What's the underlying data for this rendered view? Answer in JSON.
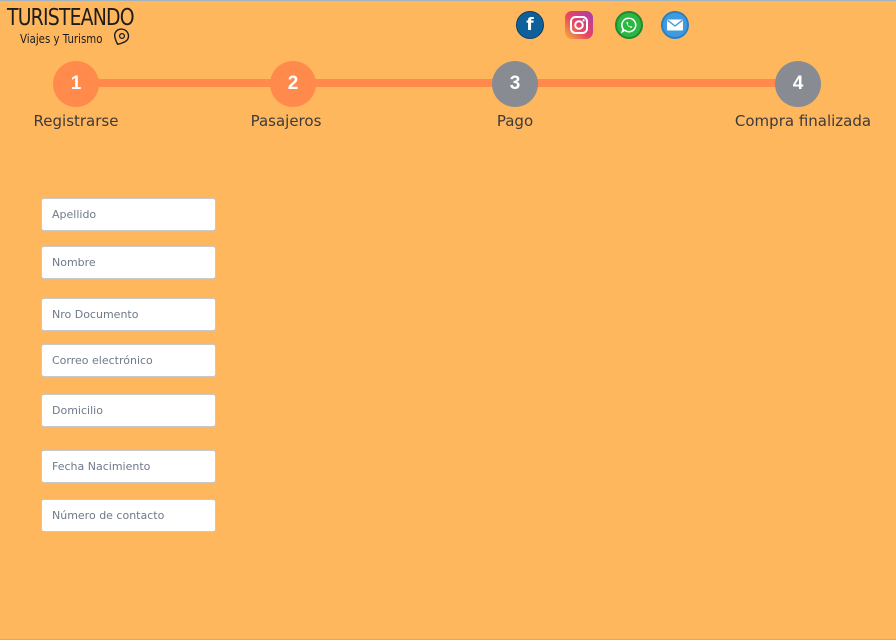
{
  "logo": {
    "title": "TURISTEANDO",
    "subtitle": "Viajes y Turismo"
  },
  "social": {
    "facebook_icon": "facebook-icon",
    "instagram_icon": "instagram-icon",
    "whatsapp_icon": "whatsapp-icon",
    "email_icon": "email-icon",
    "facebook_letter": "f"
  },
  "stepper": {
    "steps": [
      {
        "number": "1",
        "label": "Registrarse",
        "state": "done"
      },
      {
        "number": "2",
        "label": "Pasajeros",
        "state": "active"
      },
      {
        "number": "3",
        "label": "Pago",
        "state": "pending"
      },
      {
        "number": "4",
        "label": "Compra finalizada",
        "state": "pending"
      }
    ],
    "colors": {
      "done": "#ff8a4b",
      "pending": "#888c92"
    }
  },
  "form": {
    "apellido": {
      "placeholder": "Apellido",
      "value": ""
    },
    "nombre": {
      "placeholder": "Nombre",
      "value": ""
    },
    "documento": {
      "placeholder": "Nro Documento",
      "value": ""
    },
    "correo": {
      "placeholder": "Correo electrónico",
      "value": ""
    },
    "domicilio": {
      "placeholder": "Domicilio",
      "value": ""
    },
    "nacimiento": {
      "placeholder": "Fecha Nacimiento",
      "value": ""
    },
    "contacto": {
      "placeholder": "Número de contacto",
      "value": ""
    }
  },
  "colors": {
    "background": "#ffb75e",
    "accent": "#ff8a4b",
    "inactive": "#888c92"
  }
}
